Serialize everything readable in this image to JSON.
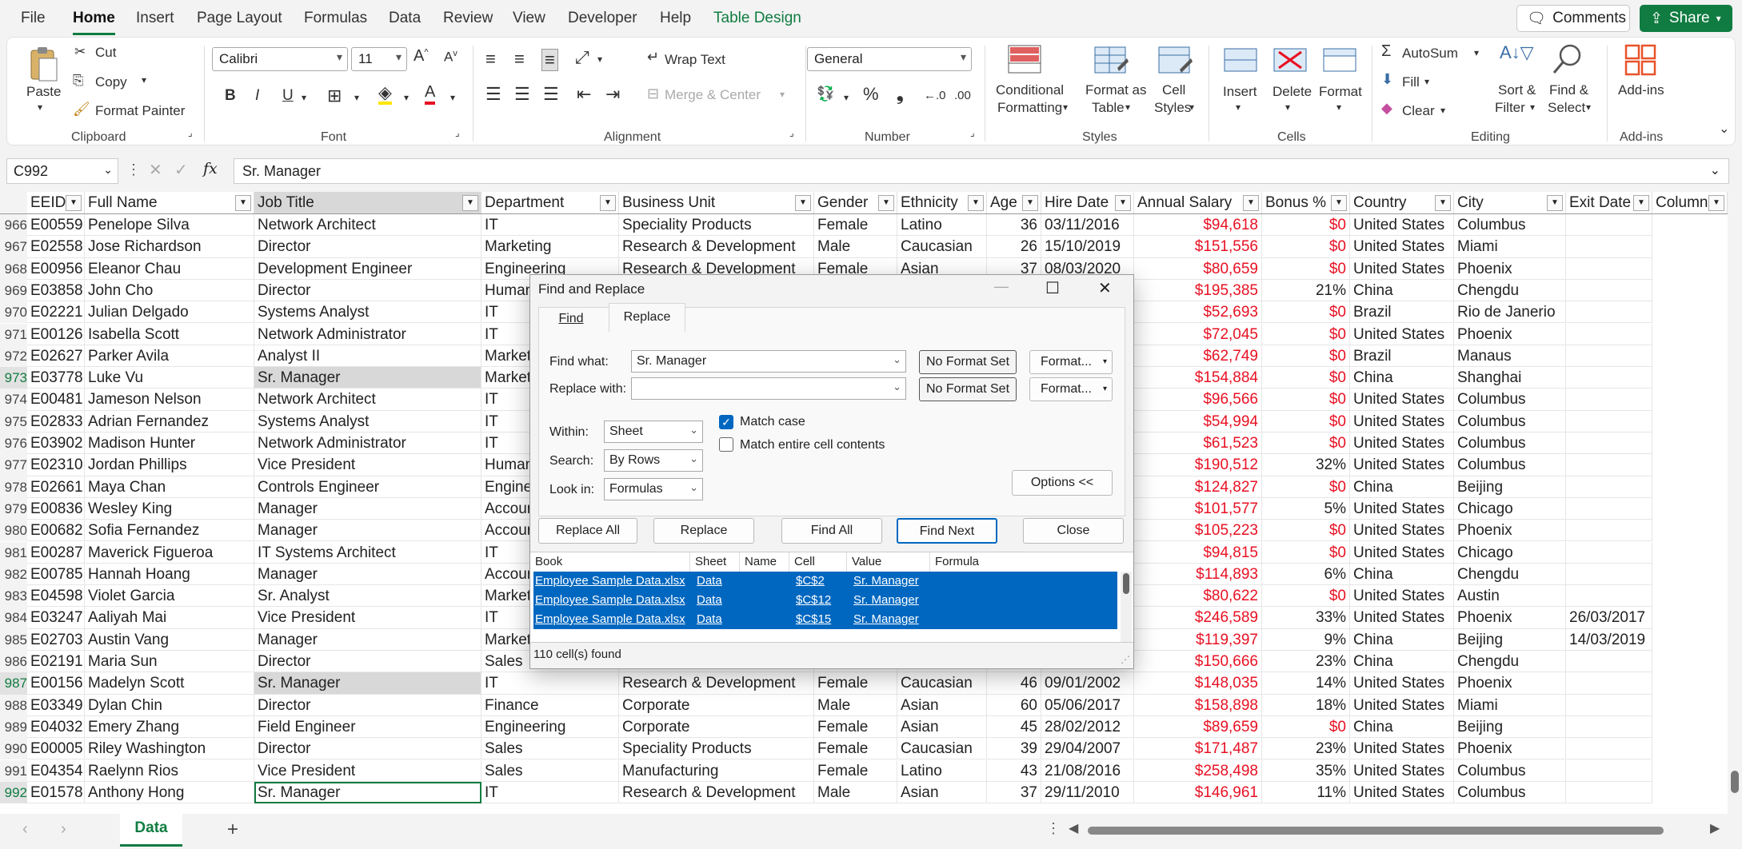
{
  "menu": {
    "items": [
      "File",
      "Home",
      "Insert",
      "Page Layout",
      "Formulas",
      "Data",
      "Review",
      "View",
      "Developer",
      "Help",
      "Table Design"
    ],
    "comments": "Comments",
    "share": "Share"
  },
  "ribbon": {
    "clipboard": {
      "paste": "Paste",
      "cut": "Cut",
      "copy": "Copy",
      "format_painter": "Format Painter",
      "label": "Clipboard"
    },
    "font": {
      "name": "Calibri",
      "size": "11",
      "label": "Font",
      "bold": "B",
      "italic": "I",
      "underline": "U"
    },
    "alignment": {
      "wrap": "Wrap Text",
      "merge": "Merge & Center",
      "label": "Alignment"
    },
    "number": {
      "format": "General",
      "label": "Number"
    },
    "styles": {
      "cond1": "Conditional",
      "cond2": "Formatting",
      "fmt1": "Format as",
      "fmt2": "Table",
      "cell1": "Cell",
      "cell2": "Styles",
      "label": "Styles"
    },
    "cells": {
      "insert": "Insert",
      "delete": "Delete",
      "format": "Format",
      "label": "Cells"
    },
    "editing": {
      "autosum": "AutoSum",
      "fill": "Fill",
      "clear": "Clear",
      "sort1": "Sort &",
      "sort2": "Filter",
      "find1": "Find &",
      "find2": "Select",
      "label": "Editing"
    },
    "addins": {
      "btn": "Add-ins",
      "label": "Add-ins"
    }
  },
  "formula_bar": {
    "name_box": "C992",
    "content": "Sr. Manager"
  },
  "table": {
    "headers": [
      "EEID",
      "Full Name",
      "Job Title",
      "Department",
      "Business Unit",
      "Gender",
      "Ethnicity",
      "Age",
      "Hire Date",
      "Annual Salary",
      "Bonus %",
      "Country",
      "City",
      "Exit Date",
      "Column"
    ],
    "rows": [
      [
        "966",
        "E00559",
        "Penelope Silva",
        "Network Architect",
        "IT",
        "Speciality Products",
        "Female",
        "Latino",
        "36",
        "03/11/2016",
        "$94,618",
        "$0",
        "United States",
        "Columbus",
        ""
      ],
      [
        "967",
        "E02558",
        "Jose Richardson",
        "Director",
        "Marketing",
        "Research & Development",
        "Male",
        "Caucasian",
        "26",
        "15/10/2019",
        "$151,556",
        "$0",
        "United States",
        "Miami",
        ""
      ],
      [
        "968",
        "E00956",
        "Eleanor Chau",
        "Development Engineer",
        "Engineering",
        "Research & Development",
        "Female",
        "Asian",
        "37",
        "08/03/2020",
        "$80,659",
        "$0",
        "United States",
        "Phoenix",
        ""
      ],
      [
        "969",
        "E03858",
        "John Cho",
        "Director",
        "Human",
        "",
        "",
        "",
        "",
        "",
        "$195,385",
        "21%",
        "China",
        "Chengdu",
        ""
      ],
      [
        "970",
        "E02221",
        "Julian Delgado",
        "Systems Analyst",
        "IT",
        "",
        "",
        "",
        "",
        "",
        "$52,693",
        "$0",
        "Brazil",
        "Rio de Janerio",
        ""
      ],
      [
        "971",
        "E00126",
        "Isabella Scott",
        "Network Administrator",
        "IT",
        "",
        "",
        "",
        "",
        "",
        "$72,045",
        "$0",
        "United States",
        "Phoenix",
        ""
      ],
      [
        "972",
        "E02627",
        "Parker Avila",
        "Analyst II",
        "Market",
        "",
        "",
        "",
        "",
        "",
        "$62,749",
        "$0",
        "Brazil",
        "Manaus",
        ""
      ],
      [
        "973",
        "E03778",
        "Luke Vu",
        "Sr. Manager",
        "Market",
        "",
        "",
        "",
        "",
        "",
        "$154,884",
        "$0",
        "China",
        "Shanghai",
        ""
      ],
      [
        "974",
        "E00481",
        "Jameson Nelson",
        "Network Architect",
        "IT",
        "",
        "",
        "",
        "",
        "",
        "$96,566",
        "$0",
        "United States",
        "Columbus",
        ""
      ],
      [
        "975",
        "E02833",
        "Adrian Fernandez",
        "Systems Analyst",
        "IT",
        "",
        "",
        "",
        "",
        "",
        "$54,994",
        "$0",
        "United States",
        "Columbus",
        ""
      ],
      [
        "976",
        "E03902",
        "Madison Hunter",
        "Network Administrator",
        "IT",
        "",
        "",
        "",
        "",
        "",
        "$61,523",
        "$0",
        "United States",
        "Columbus",
        ""
      ],
      [
        "977",
        "E02310",
        "Jordan Phillips",
        "Vice President",
        "Human",
        "",
        "",
        "",
        "",
        "",
        "$190,512",
        "32%",
        "United States",
        "Columbus",
        ""
      ],
      [
        "978",
        "E02661",
        "Maya Chan",
        "Controls Engineer",
        "Engine",
        "",
        "",
        "",
        "",
        "",
        "$124,827",
        "$0",
        "China",
        "Beijing",
        ""
      ],
      [
        "979",
        "E00836",
        "Wesley King",
        "Manager",
        "Accour",
        "",
        "",
        "",
        "",
        "",
        "$101,577",
        "5%",
        "United States",
        "Chicago",
        ""
      ],
      [
        "980",
        "E00682",
        "Sofia Fernandez",
        "Manager",
        "Accour",
        "",
        "",
        "",
        "",
        "",
        "$105,223",
        "$0",
        "United States",
        "Phoenix",
        ""
      ],
      [
        "981",
        "E00287",
        "Maverick Figueroa",
        "IT Systems Architect",
        "IT",
        "",
        "",
        "",
        "",
        "",
        "$94,815",
        "$0",
        "United States",
        "Chicago",
        ""
      ],
      [
        "982",
        "E00785",
        "Hannah Hoang",
        "Manager",
        "Accour",
        "",
        "",
        "",
        "",
        "",
        "$114,893",
        "6%",
        "China",
        "Chengdu",
        ""
      ],
      [
        "983",
        "E04598",
        "Violet Garcia",
        "Sr. Analyst",
        "Market",
        "",
        "",
        "",
        "",
        "",
        "$80,622",
        "$0",
        "United States",
        "Austin",
        ""
      ],
      [
        "984",
        "E03247",
        "Aaliyah Mai",
        "Vice President",
        "IT",
        "",
        "",
        "",
        "",
        "",
        "$246,589",
        "33%",
        "United States",
        "Phoenix",
        "26/03/2017"
      ],
      [
        "985",
        "E02703",
        "Austin Vang",
        "Manager",
        "Market",
        "",
        "",
        "",
        "",
        "",
        "$119,397",
        "9%",
        "China",
        "Beijing",
        "14/03/2019"
      ],
      [
        "986",
        "E02191",
        "Maria Sun",
        "Director",
        "Sales",
        "",
        "",
        "",
        "",
        "",
        "$150,666",
        "23%",
        "China",
        "Chengdu",
        ""
      ],
      [
        "987",
        "E00156",
        "Madelyn Scott",
        "Sr. Manager",
        "IT",
        "Research & Development",
        "Female",
        "Caucasian",
        "46",
        "09/01/2002",
        "$148,035",
        "14%",
        "United States",
        "Phoenix",
        ""
      ],
      [
        "988",
        "E03349",
        "Dylan Chin",
        "Director",
        "Finance",
        "Corporate",
        "Male",
        "Asian",
        "60",
        "05/06/2017",
        "$158,898",
        "18%",
        "United States",
        "Miami",
        ""
      ],
      [
        "989",
        "E04032",
        "Emery Zhang",
        "Field Engineer",
        "Engineering",
        "Corporate",
        "Female",
        "Asian",
        "45",
        "28/02/2012",
        "$89,659",
        "$0",
        "China",
        "Beijing",
        ""
      ],
      [
        "990",
        "E00005",
        "Riley Washington",
        "Director",
        "Sales",
        "Speciality Products",
        "Female",
        "Caucasian",
        "39",
        "29/04/2007",
        "$171,487",
        "23%",
        "United States",
        "Phoenix",
        ""
      ],
      [
        "991",
        "E04354",
        "Raelynn Rios",
        "Vice President",
        "Sales",
        "Manufacturing",
        "Female",
        "Latino",
        "43",
        "21/08/2016",
        "$258,498",
        "35%",
        "United States",
        "Columbus",
        ""
      ],
      [
        "992",
        "E01578",
        "Anthony Hong",
        "Sr. Manager",
        "IT",
        "Research & Development",
        "Male",
        "Asian",
        "37",
        "29/11/2010",
        "$146,961",
        "11%",
        "United States",
        "Columbus",
        ""
      ]
    ]
  },
  "sheet": {
    "tab": "Data"
  },
  "dialog": {
    "title": "Find and Replace",
    "tab_find": "Find",
    "tab_replace": "Replace",
    "find_label": "Find what:",
    "find_value": "Sr. Manager",
    "replace_label": "Replace with:",
    "replace_value": "",
    "no_format": "No Format Set",
    "format_btn": "Format...",
    "within_label": "Within:",
    "within_value": "Sheet",
    "search_label": "Search:",
    "search_value": "By Rows",
    "lookin_label": "Look in:",
    "lookin_value": "Formulas",
    "match_case": "Match case",
    "match_case_checked": true,
    "match_entire": "Match entire cell contents",
    "match_entire_checked": false,
    "options": "Options <<",
    "replace_all": "Replace All",
    "replace": "Replace",
    "find_all": "Find All",
    "find_next": "Find Next",
    "close": "Close",
    "results_headers": [
      "Book",
      "Sheet",
      "Name",
      "Cell",
      "Value",
      "Formula"
    ],
    "results": [
      [
        "Employee Sample Data.xlsx",
        "Data",
        "",
        "$C$2",
        "Sr. Manager",
        ""
      ],
      [
        "Employee Sample Data.xlsx",
        "Data",
        "",
        "$C$12",
        "Sr. Manager",
        ""
      ],
      [
        "Employee Sample Data.xlsx",
        "Data",
        "",
        "$C$15",
        "Sr. Manager",
        ""
      ]
    ],
    "status": "110 cell(s) found"
  },
  "colors": {
    "accent": "#107c41",
    "salary": "#e81123",
    "result_sel": "#0067c0"
  }
}
